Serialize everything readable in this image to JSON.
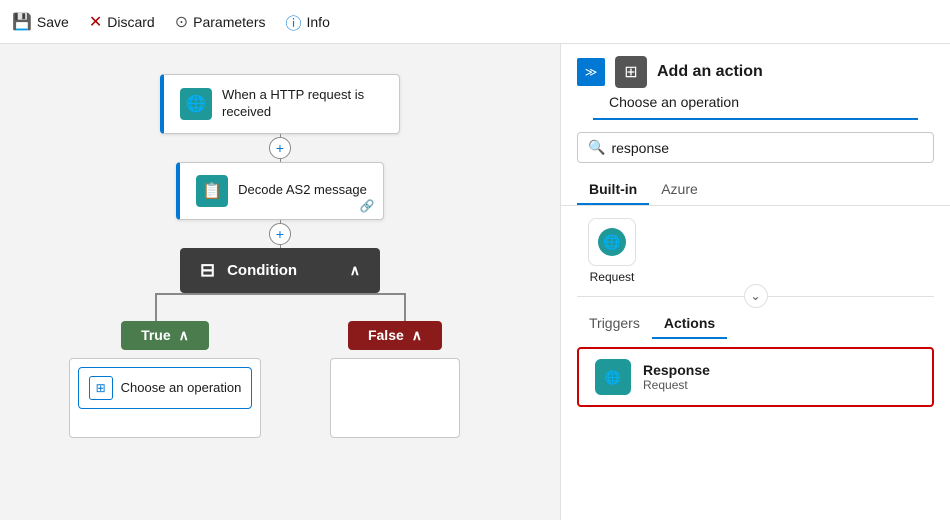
{
  "toolbar": {
    "save_label": "Save",
    "discard_label": "Discard",
    "parameters_label": "Parameters",
    "info_label": "Info"
  },
  "canvas": {
    "http_node": {
      "title": "When a HTTP request is received"
    },
    "decode_node": {
      "title": "Decode AS2 message"
    },
    "condition_node": {
      "title": "Condition"
    },
    "true_branch": {
      "label": "True"
    },
    "false_branch": {
      "label": "False"
    },
    "choose_op": {
      "label": "Choose an operation"
    }
  },
  "panel": {
    "add_action_title": "Add an action",
    "choose_operation": "Choose an operation",
    "search_placeholder": "response",
    "tabs": {
      "builtin": "Built-in",
      "azure": "Azure"
    },
    "connector_request": "Request",
    "section_tabs": {
      "triggers": "Triggers",
      "actions": "Actions"
    },
    "action": {
      "name": "Response",
      "sub": "Request"
    },
    "chevron_down": "⌄"
  }
}
